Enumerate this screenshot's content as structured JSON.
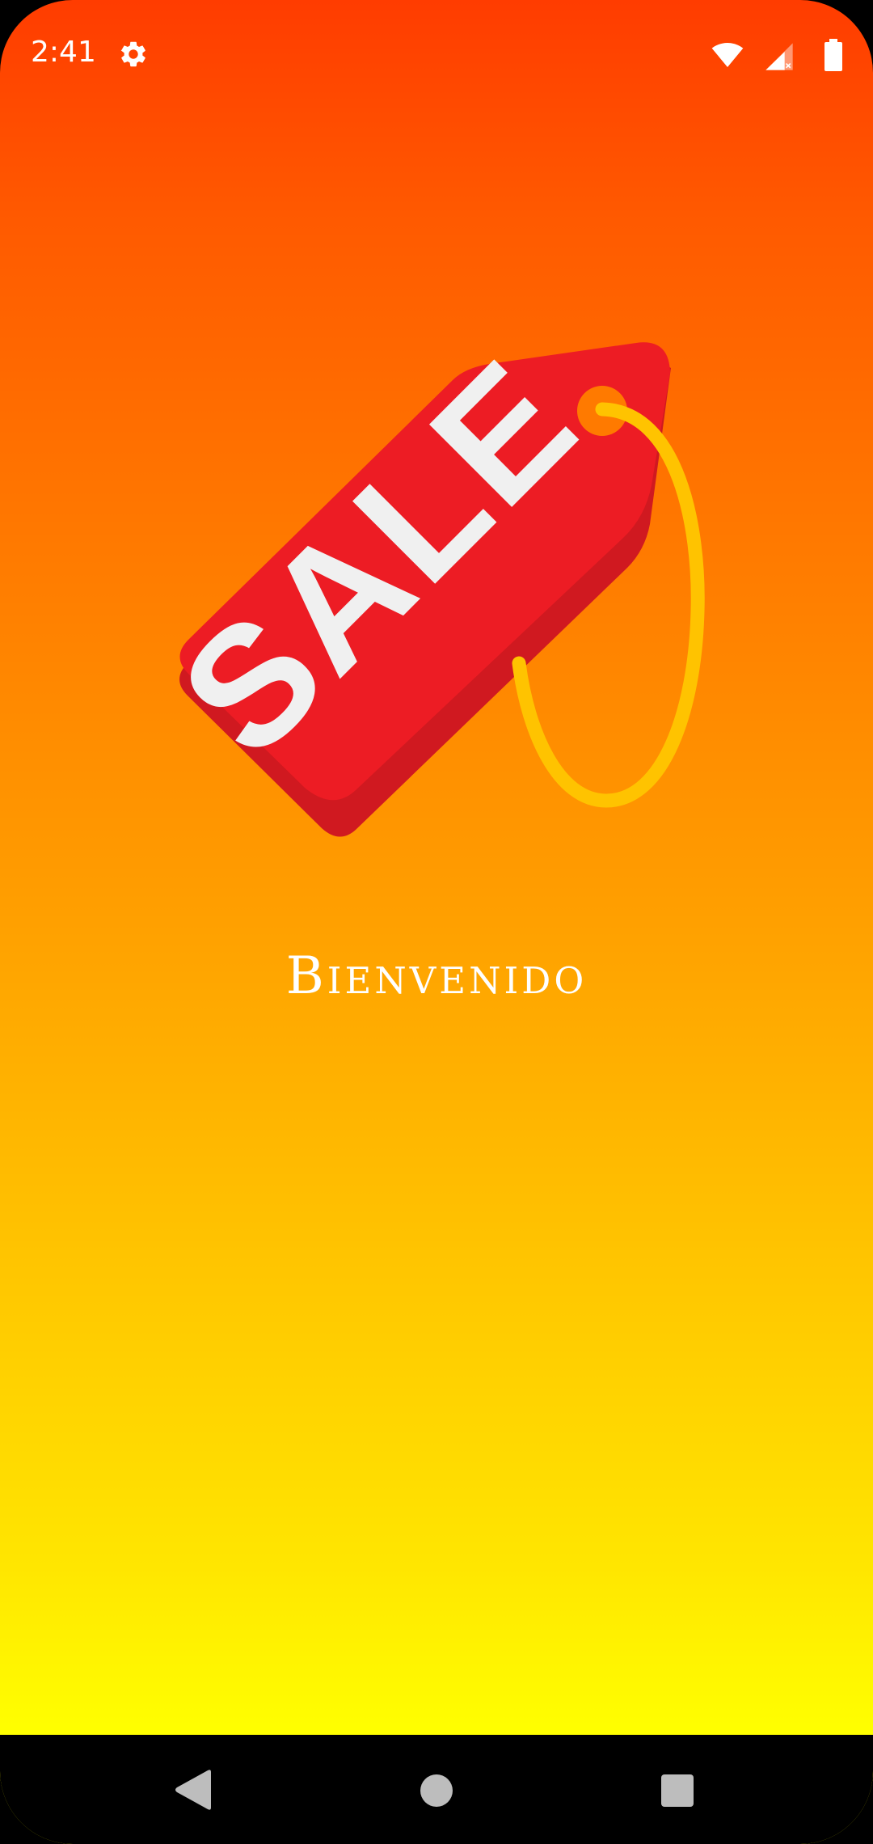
{
  "status_bar": {
    "time": "2:41",
    "icons": [
      "gear-icon",
      "wifi-icon",
      "cell-signal-icon",
      "battery-icon"
    ]
  },
  "hero": {
    "icon": "sale-tag-icon",
    "tag_text": "SALE",
    "colors": {
      "tag": "#ed1c24",
      "tag_shadow": "#d01920",
      "string": "#ffc300",
      "hole": "#ff7a00",
      "lettering": "#f0f0f0"
    }
  },
  "welcome": {
    "text": "Bienvenido"
  },
  "navigation_bar": {
    "icons": [
      "back-icon",
      "home-icon",
      "recents-icon"
    ]
  },
  "theme": {
    "gradient_top": "#ff3c00",
    "gradient_bottom": "#ffff00"
  }
}
